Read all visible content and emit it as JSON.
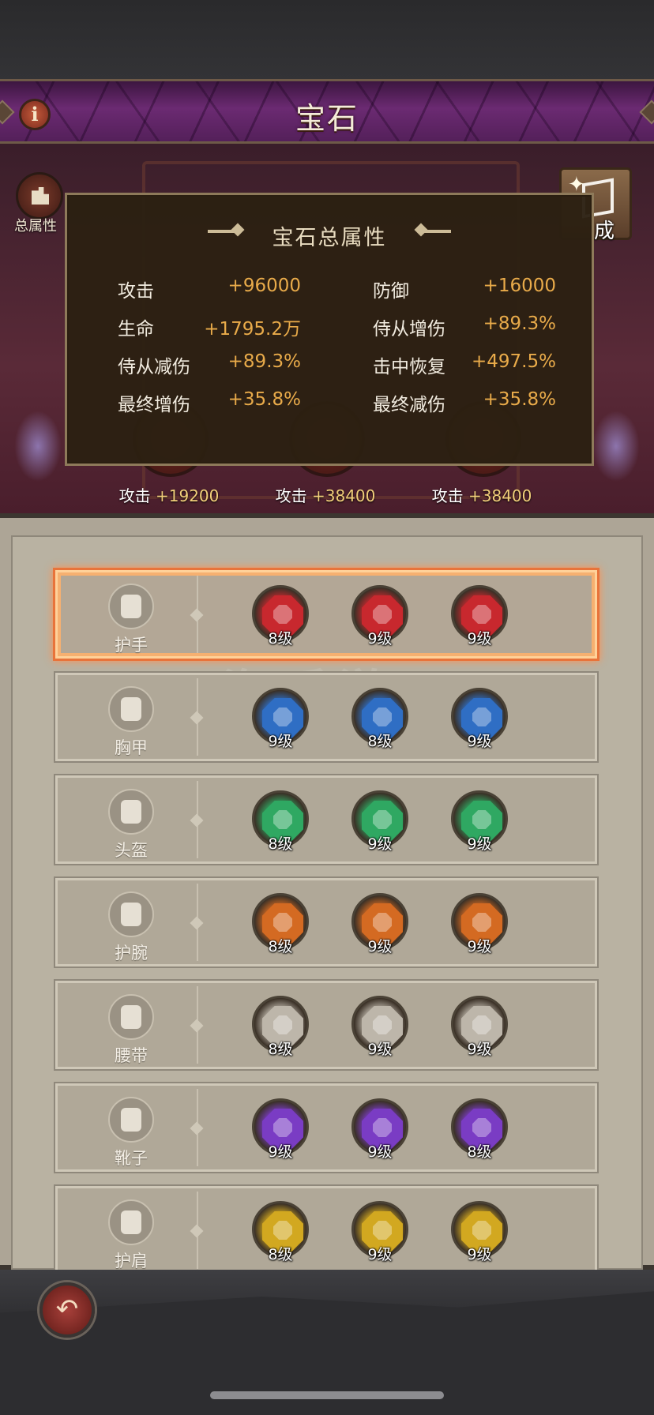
{
  "header": {
    "title": "宝石",
    "info_icon": "info-icon"
  },
  "side": {
    "total_attr_label": "总属性",
    "compose_label": "成"
  },
  "slots": [
    {
      "caption_prefix": "攻击 ",
      "value": "+19200",
      "level": "8级"
    },
    {
      "caption_prefix": "攻击 ",
      "value": "+38400",
      "level": "9级"
    },
    {
      "caption_prefix": "攻击 ",
      "value": "+38400",
      "level": "9级"
    }
  ],
  "summary": {
    "title": "宝石总属性",
    "stats": [
      {
        "label": "攻击",
        "value": "+96000"
      },
      {
        "label": "防御",
        "value": "+16000"
      },
      {
        "label": "生命",
        "value": "+1795.2万"
      },
      {
        "label": "侍从增伤",
        "value": "+89.3%"
      },
      {
        "label": "侍从减伤",
        "value": "+89.3%"
      },
      {
        "label": "击中恢复",
        "value": "+497.5%"
      },
      {
        "label": "最终增伤",
        "value": "+35.8%"
      },
      {
        "label": "最终减伤",
        "value": "+35.8%"
      }
    ]
  },
  "equipment": [
    {
      "name": "护手",
      "color": "#c8282e",
      "gems": [
        "8级",
        "9级",
        "9级"
      ],
      "selected": true
    },
    {
      "name": "胸甲",
      "color": "#2f6ec4",
      "gems": [
        "9级",
        "8级",
        "9级"
      ]
    },
    {
      "name": "头盔",
      "color": "#2fa862",
      "gems": [
        "8级",
        "9级",
        "9级"
      ]
    },
    {
      "name": "护腕",
      "color": "#d46a22",
      "gems": [
        "8级",
        "9级",
        "9级"
      ]
    },
    {
      "name": "腰带",
      "color": "#bdb6aa",
      "gems": [
        "8级",
        "9级",
        "9级"
      ]
    },
    {
      "name": "靴子",
      "color": "#7a3cc4",
      "gems": [
        "9级",
        "9级",
        "8级"
      ]
    },
    {
      "name": "护肩",
      "color": "#d2a820",
      "gems": [
        "8级",
        "9级",
        "9级"
      ]
    }
  ],
  "watermark": "淘手游",
  "colors": {
    "stat_value": "#e9ab4a",
    "title_bar": "#6b2a72",
    "selected_outline": "#e8733a"
  }
}
